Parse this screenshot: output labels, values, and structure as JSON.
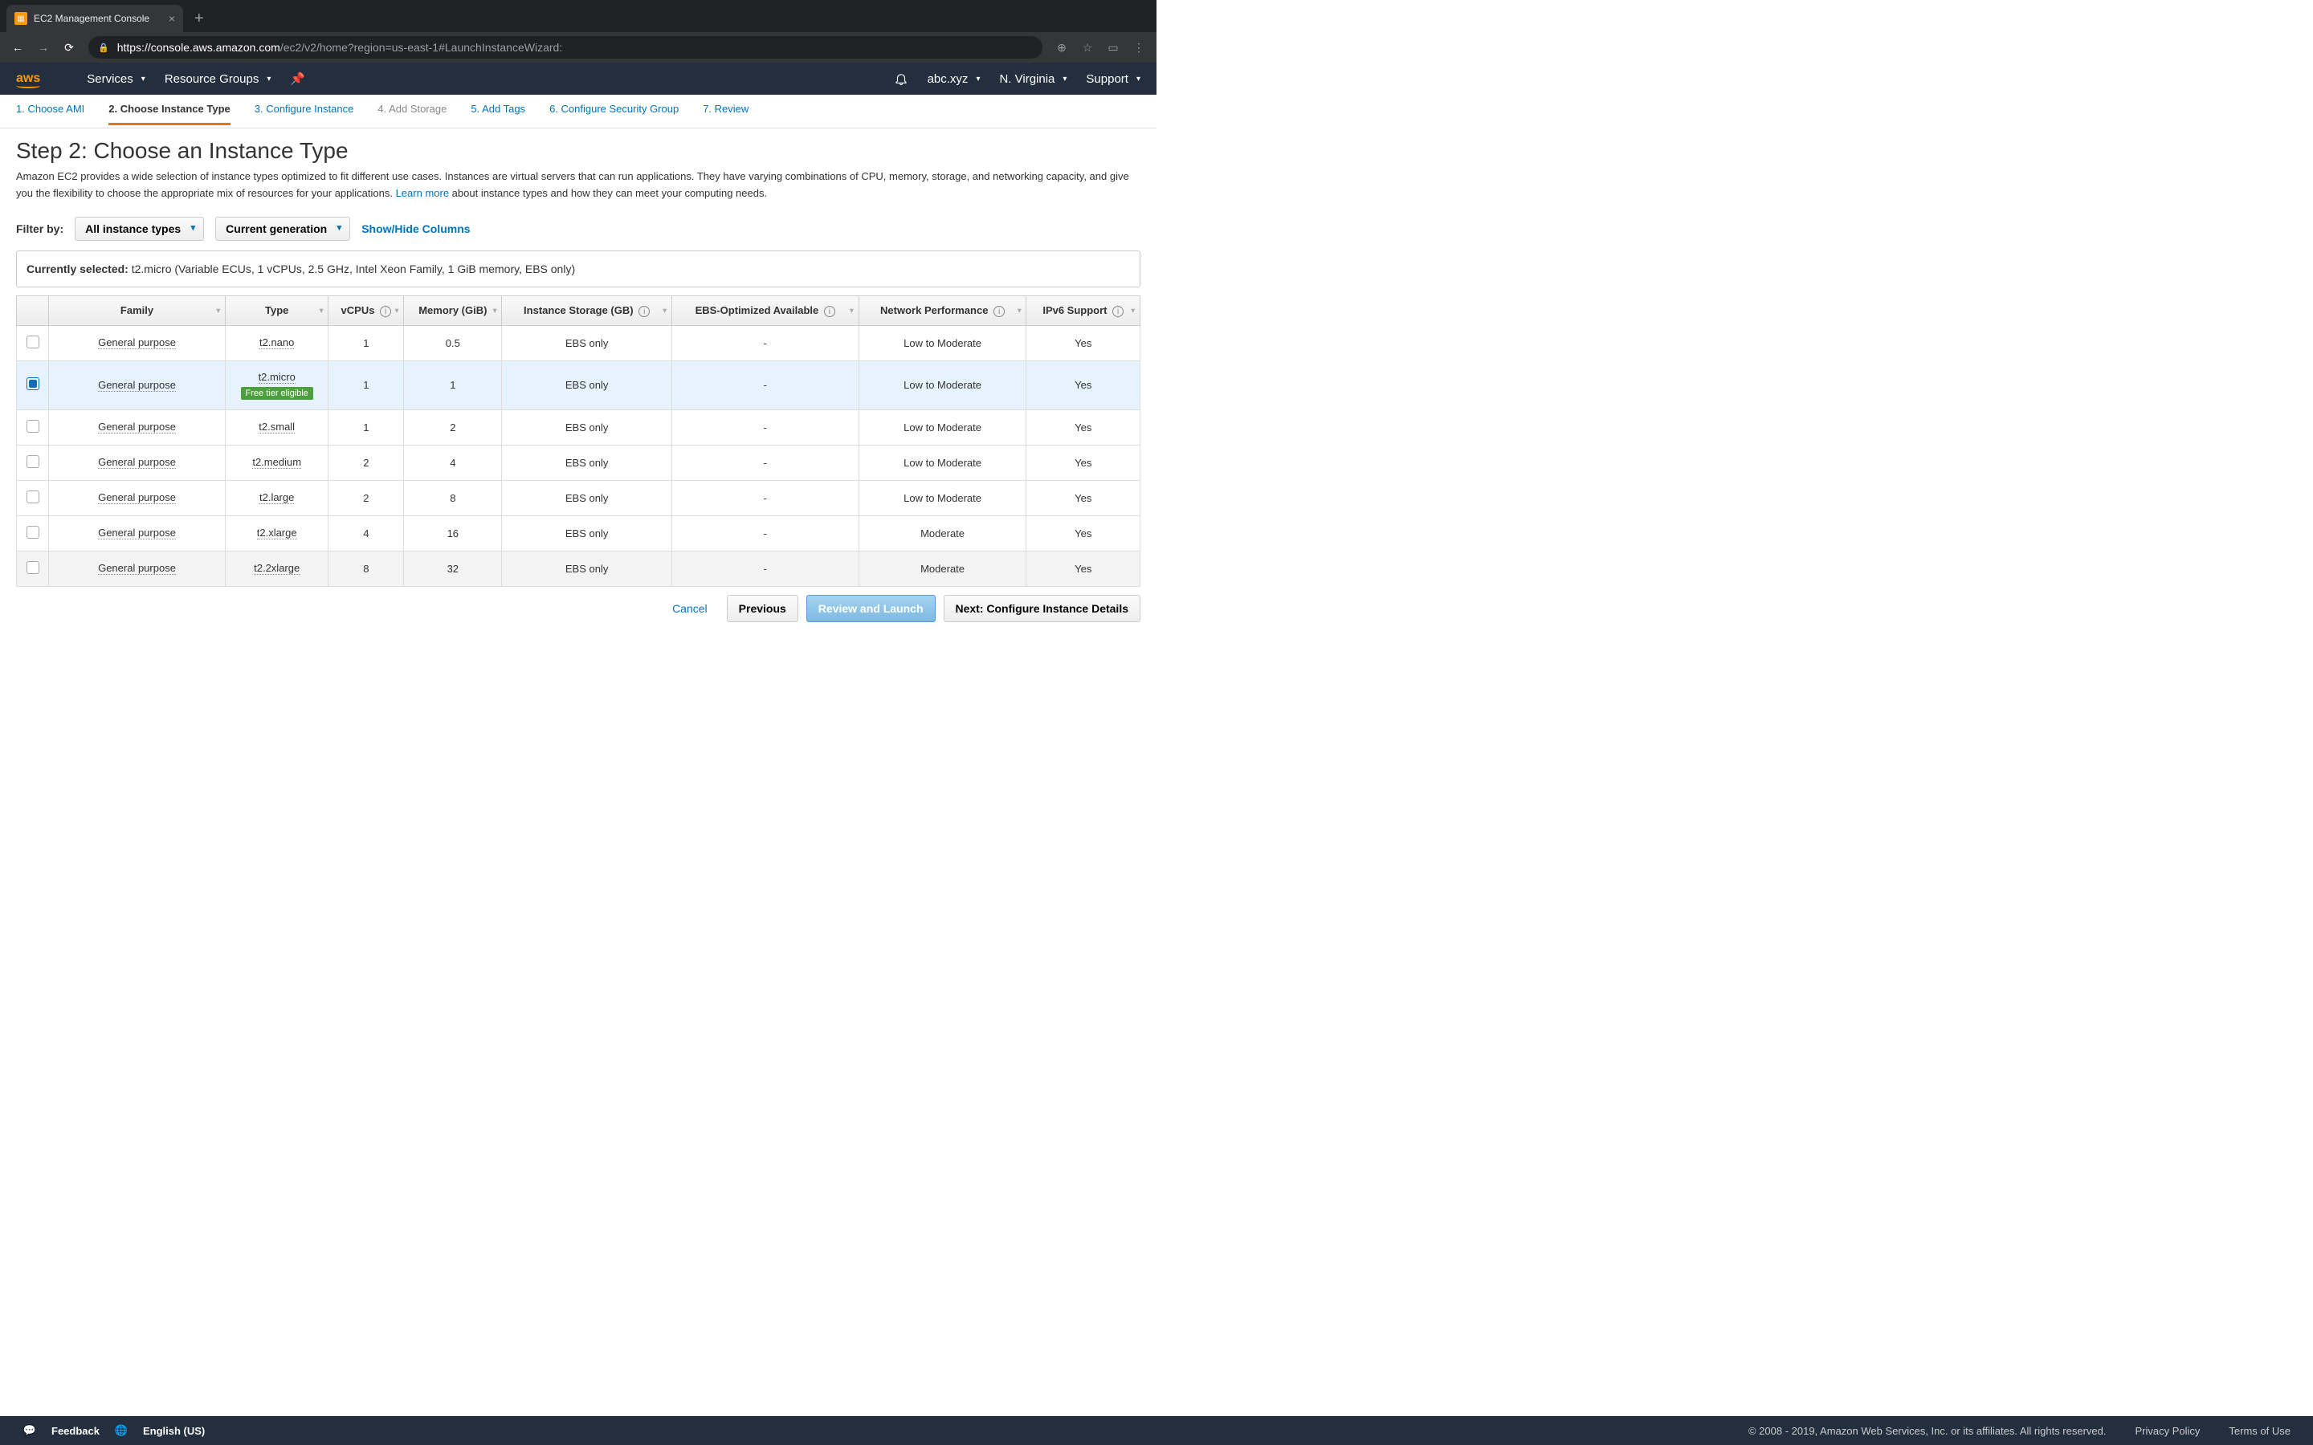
{
  "browser": {
    "tab_title": "EC2 Management Console",
    "url_host": "https://console.aws.amazon.com",
    "url_path": "/ec2/v2/home?region=us-east-1#LaunchInstanceWizard:"
  },
  "header": {
    "services": "Services",
    "resource_groups": "Resource Groups",
    "account": "abc.xyz",
    "region": "N. Virginia",
    "support": "Support"
  },
  "wizard": {
    "steps": [
      "1. Choose AMI",
      "2. Choose Instance Type",
      "3. Configure Instance",
      "4. Add Storage",
      "5. Add Tags",
      "6. Configure Security Group",
      "7. Review"
    ]
  },
  "page": {
    "title": "Step 2: Choose an Instance Type",
    "description_pre": "Amazon EC2 provides a wide selection of instance types optimized to fit different use cases. Instances are virtual servers that can run applications. They have varying combinations of CPU, memory, storage, and networking capacity, and give you the flexibility to choose the appropriate mix of resources for your applications. ",
    "learn_more": "Learn more",
    "description_post": " about instance types and how they can meet your computing needs."
  },
  "filters": {
    "label": "Filter by:",
    "all_types": "All instance types",
    "generation": "Current generation",
    "columns_toggle": "Show/Hide Columns"
  },
  "selected": {
    "label": "Currently selected:",
    "text": " t2.micro (Variable ECUs, 1 vCPUs, 2.5 GHz, Intel Xeon Family, 1 GiB memory, EBS only)"
  },
  "table": {
    "headers": {
      "family": "Family",
      "type": "Type",
      "vcpus": "vCPUs",
      "memory": "Memory (GiB)",
      "storage": "Instance Storage (GB)",
      "ebs": "EBS-Optimized Available",
      "network": "Network Performance",
      "ipv6": "IPv6 Support"
    },
    "free_tier_badge": "Free tier eligible",
    "rows": [
      {
        "family": "General purpose",
        "type": "t2.nano",
        "vcpus": "1",
        "memory": "0.5",
        "storage": "EBS only",
        "ebs": "-",
        "network": "Low to Moderate",
        "ipv6": "Yes",
        "selected": false
      },
      {
        "family": "General purpose",
        "type": "t2.micro",
        "vcpus": "1",
        "memory": "1",
        "storage": "EBS only",
        "ebs": "-",
        "network": "Low to Moderate",
        "ipv6": "Yes",
        "selected": true,
        "free_tier": true
      },
      {
        "family": "General purpose",
        "type": "t2.small",
        "vcpus": "1",
        "memory": "2",
        "storage": "EBS only",
        "ebs": "-",
        "network": "Low to Moderate",
        "ipv6": "Yes",
        "selected": false
      },
      {
        "family": "General purpose",
        "type": "t2.medium",
        "vcpus": "2",
        "memory": "4",
        "storage": "EBS only",
        "ebs": "-",
        "network": "Low to Moderate",
        "ipv6": "Yes",
        "selected": false
      },
      {
        "family": "General purpose",
        "type": "t2.large",
        "vcpus": "2",
        "memory": "8",
        "storage": "EBS only",
        "ebs": "-",
        "network": "Low to Moderate",
        "ipv6": "Yes",
        "selected": false
      },
      {
        "family": "General purpose",
        "type": "t2.xlarge",
        "vcpus": "4",
        "memory": "16",
        "storage": "EBS only",
        "ebs": "-",
        "network": "Moderate",
        "ipv6": "Yes",
        "selected": false
      },
      {
        "family": "General purpose",
        "type": "t2.2xlarge",
        "vcpus": "8",
        "memory": "32",
        "storage": "EBS only",
        "ebs": "-",
        "network": "Moderate",
        "ipv6": "Yes",
        "selected": false
      }
    ]
  },
  "buttons": {
    "cancel": "Cancel",
    "previous": "Previous",
    "review": "Review and Launch",
    "next": "Next: Configure Instance Details"
  },
  "footer": {
    "feedback": "Feedback",
    "language": "English (US)",
    "copyright": "© 2008 - 2019, Amazon Web Services, Inc. or its affiliates. All rights reserved.",
    "privacy": "Privacy Policy",
    "terms": "Terms of Use"
  }
}
